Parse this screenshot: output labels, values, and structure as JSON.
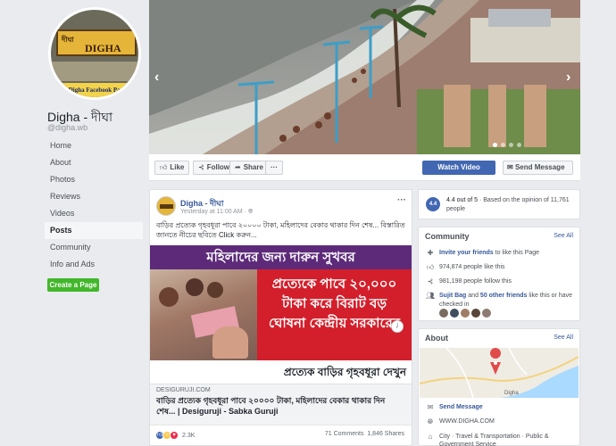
{
  "page": {
    "name": "Digha - দীঘা",
    "handle": "@digha.wb",
    "avatar_sign_top": "দীঘা",
    "avatar_sign_main": "DIGHA",
    "avatar_ribbon": "Digha Facebook Page"
  },
  "nav": {
    "items": [
      {
        "label": "Home"
      },
      {
        "label": "About"
      },
      {
        "label": "Photos"
      },
      {
        "label": "Reviews"
      },
      {
        "label": "Videos"
      },
      {
        "label": "Posts"
      },
      {
        "label": "Community"
      },
      {
        "label": "Info and Ads"
      }
    ],
    "active": "Posts",
    "create_page_label": "Create a Page"
  },
  "cover": {
    "prev_icon": "chevron-left-icon",
    "next_icon": "chevron-right-icon",
    "dots_total": 4,
    "dots_active": 1
  },
  "actions": {
    "like_label": "Like",
    "follow_label": "Follow",
    "share_label": "Share",
    "more_label": "···",
    "watch_video_label": "Watch Video",
    "send_message_label": "Send Message"
  },
  "post": {
    "author": "Digha - দীঘা",
    "time": "Yesterday at 11:00 AM · ",
    "more_label": "···",
    "text": "বাড়ির প্রত্যেক গৃহবধূরা পাবে ২০০০০ টাকা, মহিলাদের বেকার থাকার দিন শেষ... বিস্তারিত জানতে নীচের ছবিতে Click করুন...",
    "image": {
      "banner": "মহিলাদের জন্য দারুন সুখবর",
      "red_line1": "প্রত্যেকে পাবে ২০,০০০",
      "red_line2": "টাকা করে বিরাট বড়",
      "red_line3": "ঘোষনা কেন্দ্রীয় সরকারের",
      "caption": "প্রত্যেক বাড়ির গৃহবধূরা দেখুন",
      "info_label": "i"
    },
    "link": {
      "domain": "DESIGURUJI.COM",
      "title": "বাড়ির প্রত্যেক গৃহবধূরা পাবে ২০০০০ টাকা, মহিলাদের বেকার থাকার দিন শেষ... | Desiguruji - Sabka Guruji"
    },
    "reactions_count": "2.3K",
    "comments": "71 Comments",
    "shares": "1,846 Shares"
  },
  "rating": {
    "badge": "4.4",
    "score": "4.4 out of 5",
    "detail": " · Based on the opinion of 11,761 people"
  },
  "community": {
    "title": "Community",
    "see_all": "See All",
    "invite_link": "Invite your friends",
    "invite_rest": " to like this Page",
    "likes": "974,874 people like this",
    "follows": "981,198 people follow this",
    "friends_name": "Sujit Bag",
    "friends_and": " and ",
    "friends_others": "50 other friends",
    "friends_rest": " like this or have checked in"
  },
  "about": {
    "title": "About",
    "see_all": "See All",
    "map_label": "Digha",
    "send_message": "Send Message",
    "website": "WWW.DIGHA.COM",
    "category": "City · Travel & Transportation · Public & Government Service"
  },
  "colors": {
    "facebook_blue": "#4267b2",
    "link_blue": "#365899",
    "create_green": "#42b72a",
    "banner_purple": "#5d2a7a",
    "banner_red": "#d21f2b"
  }
}
